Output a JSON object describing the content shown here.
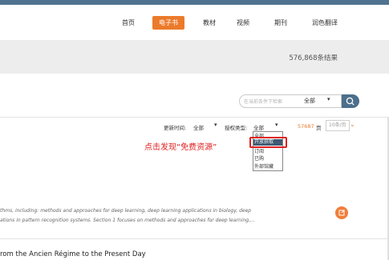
{
  "nav": {
    "home": "首页",
    "ebooks": "电子书",
    "materials": "教材",
    "video": "视频",
    "journals": "期刊",
    "translate": "润色翻译"
  },
  "results": {
    "count_text": "576,868条结果"
  },
  "search": {
    "placeholder": "在当前条件下检索",
    "scope": "全部"
  },
  "filters": {
    "update_time_label": "更新时间:",
    "update_time_value": "全部",
    "auth_type_label": "授权类型:",
    "auth_type_value": "全部",
    "pages_count": "57687",
    "pages_unit": "页",
    "per_page": "10条/页"
  },
  "auth_options": [
    "全部",
    "开放获取",
    "订阅",
    "已购",
    "外部馆藏"
  ],
  "annotation": "点击发现“免费资源”",
  "result1": {
    "line1": "thms, including: methods and approaches for deep learning, deep learning applications in biology, deep",
    "line2": "ations in pattern recognition systems. Section 1 focuses on methods and approaches for deep learning,..."
  },
  "result2": {
    "title": "rom the Ancien Régime to the Present Day"
  },
  "colors": {
    "accent": "#ec7a2b",
    "primary": "#4c6f8c",
    "highlight": "#e02020"
  },
  "icons": {
    "search": "search-icon",
    "result_action": "external-link-icon"
  }
}
